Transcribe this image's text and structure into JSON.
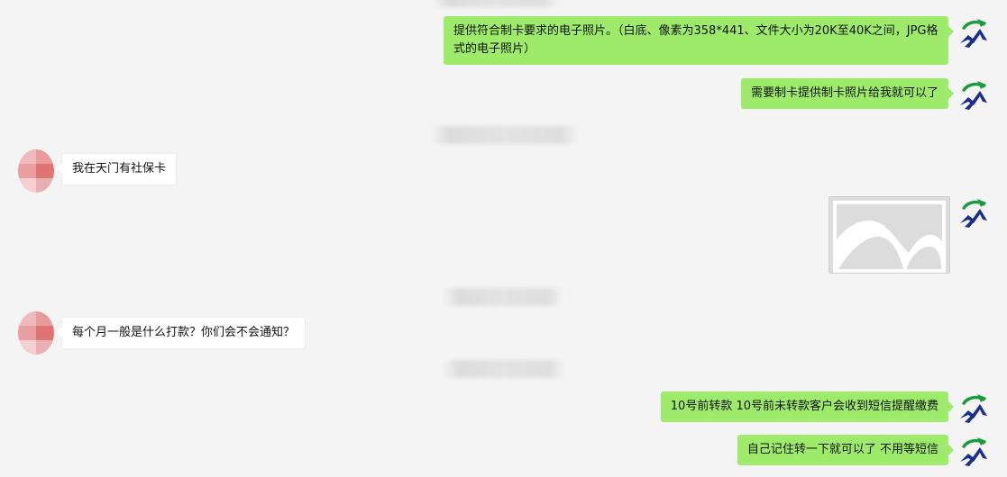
{
  "colors": {
    "background": "#f4f4f4",
    "self_bubble": "#9eea6a",
    "other_bubble": "#ffffff",
    "avatar_green": "#1a9b3c",
    "avatar_blue": "#1b2e8a",
    "avatar_pink": "#e8a2a4"
  },
  "icons": {
    "self_avatar": "logo-avatar-icon",
    "other_avatar": "pixelated-avatar"
  },
  "messages": [
    {
      "sender": "self",
      "type": "text",
      "text": "提供符合制卡要求的电子照片。（白底、像素为358*441、文件大小为20K至40K之间，JPG格式的电子照片）"
    },
    {
      "sender": "self",
      "type": "text",
      "text": "需要制卡提供制卡照片给我就可以了"
    },
    {
      "sender": "other",
      "type": "text",
      "text": "我在天门有社保卡"
    },
    {
      "sender": "self",
      "type": "image",
      "icon": "image-placeholder-icon"
    },
    {
      "sender": "other",
      "type": "text",
      "text": "每个月一般是什么打款？你们会不会通知？"
    },
    {
      "sender": "self",
      "type": "text",
      "text": "10号前转款 10号前未转款客户会收到短信提醒缴费"
    },
    {
      "sender": "self",
      "type": "text",
      "text": "自己记住转一下就可以了 不用等短信"
    }
  ]
}
